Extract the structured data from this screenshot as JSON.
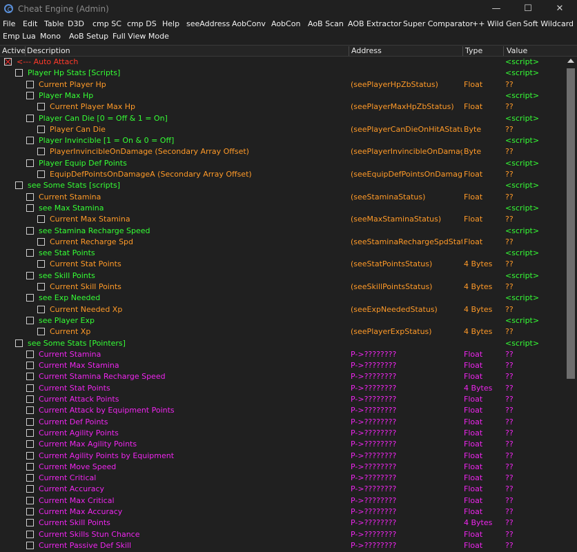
{
  "window": {
    "title": "Cheat Engine (Admin)",
    "minimize": "—",
    "maximize": "☐",
    "close": "✕"
  },
  "menu": {
    "row1": [
      "File",
      "Edit",
      "Table",
      "D3D",
      "cmp SC",
      "cmp DS",
      "Help",
      "seeAddress",
      "AobConv",
      "AobCon",
      "AoB Scan",
      "AOB Extractor",
      "Super Comparator",
      "++ Wild Gen",
      "Soft Wildcard"
    ],
    "row2": [
      "Emp Lua",
      "Mono",
      "AoB Setup",
      "Full View Mode"
    ]
  },
  "columns": {
    "active": "Active",
    "description": "Description",
    "address": "Address",
    "type": "Type",
    "value": "Value"
  },
  "colors": {
    "auto_attach": "#ff3a2a",
    "script": "#35ff35",
    "data": "#ff9a28",
    "pointer": "#ee25ee",
    "value": "#ff9a28"
  },
  "rows": [
    {
      "level": 0,
      "kind": "auto_attach",
      "checked": true,
      "desc": "<--- Auto Attach",
      "addr": "",
      "type": "",
      "value": "<script>"
    },
    {
      "level": 1,
      "kind": "script",
      "desc": "Player Hp Stats [Scripts]",
      "addr": "",
      "type": "",
      "value": "<script>"
    },
    {
      "level": 2,
      "kind": "data",
      "desc": "Current Player Hp",
      "addr": "(seePlayerHpZbStatus)",
      "type": "Float",
      "value": "??"
    },
    {
      "level": 2,
      "kind": "script",
      "desc": "Player Max Hp",
      "addr": "",
      "type": "",
      "value": "<script>"
    },
    {
      "level": 3,
      "kind": "data",
      "desc": "Current Player Max Hp",
      "addr": "(seePlayerMaxHpZbStatus)",
      "type": "Float",
      "value": "??"
    },
    {
      "level": 2,
      "kind": "script",
      "desc": "Player Can Die [0 = Off & 1 = On]",
      "addr": "",
      "type": "",
      "value": "<script>"
    },
    {
      "level": 3,
      "kind": "data",
      "desc": "Player Can Die",
      "addr": "(seePlayerCanDieOnHitAStatus)",
      "type": "Byte",
      "value": "??"
    },
    {
      "level": 2,
      "kind": "script",
      "desc": "Player Invincible [1 = On & 0 = Off]",
      "addr": "",
      "type": "",
      "value": "<script>"
    },
    {
      "level": 3,
      "kind": "data",
      "desc": "PlayerInvincibleOnDamage (Secondary Array Offset)",
      "addr": "(seePlayerInvincibleOnDamageStat",
      "type": "Byte",
      "value": "??"
    },
    {
      "level": 2,
      "kind": "script",
      "desc": "Player Equip Def Points",
      "addr": "",
      "type": "",
      "value": "<script>"
    },
    {
      "level": 3,
      "kind": "data",
      "desc": "EquipDefPointsOnDamageA (Secondary Array Offset)",
      "addr": "(seeEquipDefPointsOnDamageASt",
      "type": "Float",
      "value": "??"
    },
    {
      "level": 1,
      "kind": "script",
      "desc": "see Some Stats [scripts]",
      "addr": "",
      "type": "",
      "value": "<script>"
    },
    {
      "level": 2,
      "kind": "data",
      "desc": "Current Stamina",
      "addr": "(seeStaminaStatus)",
      "type": "Float",
      "value": "??"
    },
    {
      "level": 2,
      "kind": "script",
      "desc": "see Max Stamina",
      "addr": "",
      "type": "",
      "value": "<script>"
    },
    {
      "level": 3,
      "kind": "data",
      "desc": "Current Max Stamina",
      "addr": "(seeMaxStaminaStatus)",
      "type": "Float",
      "value": "??"
    },
    {
      "level": 2,
      "kind": "script",
      "desc": "see Stamina Recharge Speed",
      "addr": "",
      "type": "",
      "value": "<script>"
    },
    {
      "level": 3,
      "kind": "data",
      "desc": "Current Recharge Spd",
      "addr": "(seeStaminaRechargeSpdStatus)",
      "type": "Float",
      "value": "??"
    },
    {
      "level": 2,
      "kind": "script",
      "desc": "see Stat Points",
      "addr": "",
      "type": "",
      "value": "<script>"
    },
    {
      "level": 3,
      "kind": "data",
      "desc": "Current Stat Points",
      "addr": "(seeStatPointsStatus)",
      "type": "4 Bytes",
      "value": "??"
    },
    {
      "level": 2,
      "kind": "script",
      "desc": "see Skill Points",
      "addr": "",
      "type": "",
      "value": "<script>"
    },
    {
      "level": 3,
      "kind": "data",
      "desc": "Current Skill Points",
      "addr": "(seeSkillPointsStatus)",
      "type": "4 Bytes",
      "value": "??"
    },
    {
      "level": 2,
      "kind": "script",
      "desc": "see Exp Needed",
      "addr": "",
      "type": "",
      "value": "<script>"
    },
    {
      "level": 3,
      "kind": "data",
      "desc": "Current Needed Xp",
      "addr": "(seeExpNeededStatus)",
      "type": "4 Bytes",
      "value": "??"
    },
    {
      "level": 2,
      "kind": "script",
      "desc": "see Player Exp",
      "addr": "",
      "type": "",
      "value": "<script>"
    },
    {
      "level": 3,
      "kind": "data",
      "desc": "Current Xp",
      "addr": "(seePlayerExpStatus)",
      "type": "4 Bytes",
      "value": "??"
    },
    {
      "level": 1,
      "kind": "script",
      "desc": "see Some Stats [Pointers]",
      "addr": "",
      "type": "",
      "value": "<script>"
    },
    {
      "level": 2,
      "kind": "pointer",
      "desc": "Current Stamina",
      "addr": "P->????????",
      "type": "Float",
      "value": "??"
    },
    {
      "level": 2,
      "kind": "pointer",
      "desc": "Current Max Stamina",
      "addr": "P->????????",
      "type": "Float",
      "value": "??"
    },
    {
      "level": 2,
      "kind": "pointer",
      "desc": "Current Stamina Recharge Speed",
      "addr": "P->????????",
      "type": "Float",
      "value": "??"
    },
    {
      "level": 2,
      "kind": "pointer",
      "desc": "Current Stat Points",
      "addr": "P->????????",
      "type": "4 Bytes",
      "value": "??"
    },
    {
      "level": 2,
      "kind": "pointer",
      "desc": "Current Attack Points",
      "addr": "P->????????",
      "type": "Float",
      "value": "??"
    },
    {
      "level": 2,
      "kind": "pointer",
      "desc": "Current Attack by Equipment Points",
      "addr": "P->????????",
      "type": "Float",
      "value": "??"
    },
    {
      "level": 2,
      "kind": "pointer",
      "desc": "Current Def Points",
      "addr": "P->????????",
      "type": "Float",
      "value": "??"
    },
    {
      "level": 2,
      "kind": "pointer",
      "desc": "Current Agility Points",
      "addr": "P->????????",
      "type": "Float",
      "value": "??"
    },
    {
      "level": 2,
      "kind": "pointer",
      "desc": "Current Max Agility Points",
      "addr": "P->????????",
      "type": "Float",
      "value": "??"
    },
    {
      "level": 2,
      "kind": "pointer",
      "desc": "Current Agility Points by Equipment",
      "addr": "P->????????",
      "type": "Float",
      "value": "??"
    },
    {
      "level": 2,
      "kind": "pointer",
      "desc": "Current Move Speed",
      "addr": "P->????????",
      "type": "Float",
      "value": "??"
    },
    {
      "level": 2,
      "kind": "pointer",
      "desc": "Current Critical",
      "addr": "P->????????",
      "type": "Float",
      "value": "??"
    },
    {
      "level": 2,
      "kind": "pointer",
      "desc": "Current Accuracy",
      "addr": "P->????????",
      "type": "Float",
      "value": "??"
    },
    {
      "level": 2,
      "kind": "pointer",
      "desc": "Current Max Critical",
      "addr": "P->????????",
      "type": "Float",
      "value": "??"
    },
    {
      "level": 2,
      "kind": "pointer",
      "desc": "Current Max Accuracy",
      "addr": "P->????????",
      "type": "Float",
      "value": "??"
    },
    {
      "level": 2,
      "kind": "pointer",
      "desc": "Current Skill Points",
      "addr": "P->????????",
      "type": "4 Bytes",
      "value": "??"
    },
    {
      "level": 2,
      "kind": "pointer",
      "desc": "Current Skills Stun Chance",
      "addr": "P->????????",
      "type": "Float",
      "value": "??"
    },
    {
      "level": 2,
      "kind": "pointer",
      "desc": "Current Passive Def Skill",
      "addr": "P->????????",
      "type": "Float",
      "value": "??"
    }
  ]
}
